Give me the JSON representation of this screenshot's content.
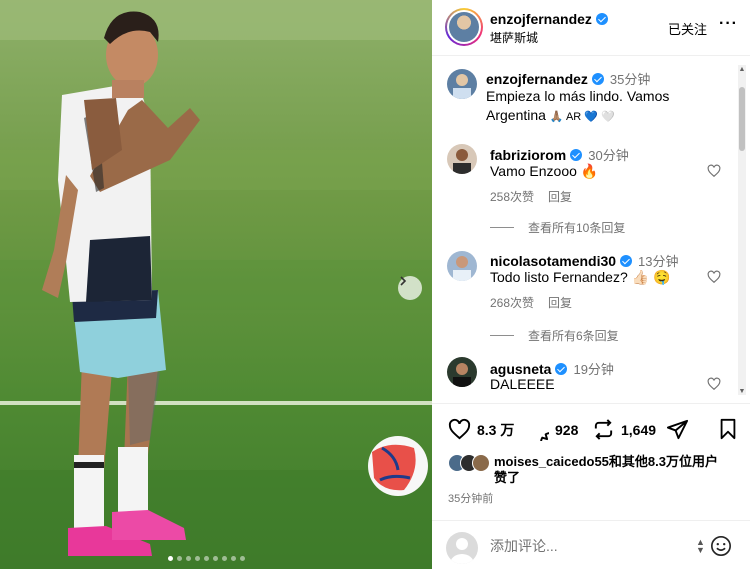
{
  "header": {
    "username": "enzojfernandez",
    "location": "堪萨斯城",
    "follow_label": "已关注",
    "more_label": "···"
  },
  "caption": {
    "username": "enzojfernandez",
    "time": "35分钟",
    "text_line1": "Empieza lo más lindo. Vamos",
    "text_line2_text": "Argentina",
    "text_line2_emoji": "🙏🏽 AR 💙 🤍"
  },
  "comments": [
    {
      "username": "fabriziorom",
      "time": "30分钟",
      "text": "Vamo Enzooo 🔥",
      "likes": "258次赞",
      "reply_label": "回复",
      "view_replies": "查看所有10条回复"
    },
    {
      "username": "nicolasotamendi30",
      "time": "13分钟",
      "text": "Todo listo Fernandez? 👍🏻 🤤",
      "likes": "268次赞",
      "reply_label": "回复",
      "view_replies": "查看所有6条回复"
    },
    {
      "username": "agusneta",
      "time": "19分钟",
      "text": "DALEEEE"
    }
  ],
  "actions": {
    "like_count": "8.3 万",
    "comment_count": "928",
    "repost_count": "1,649"
  },
  "liked_by": {
    "line1": "moises_caicedo55和其他8.3万位用户",
    "line2": "赞了"
  },
  "timestamp": "35分钟前",
  "add_comment": {
    "placeholder": "添加评论..."
  },
  "carousel": {
    "dot_count": 9,
    "active_dot": 1
  },
  "colors": {
    "verified": "#1e90ff",
    "muted_text": "#737373",
    "pitch_green": "#5f8d3a"
  }
}
